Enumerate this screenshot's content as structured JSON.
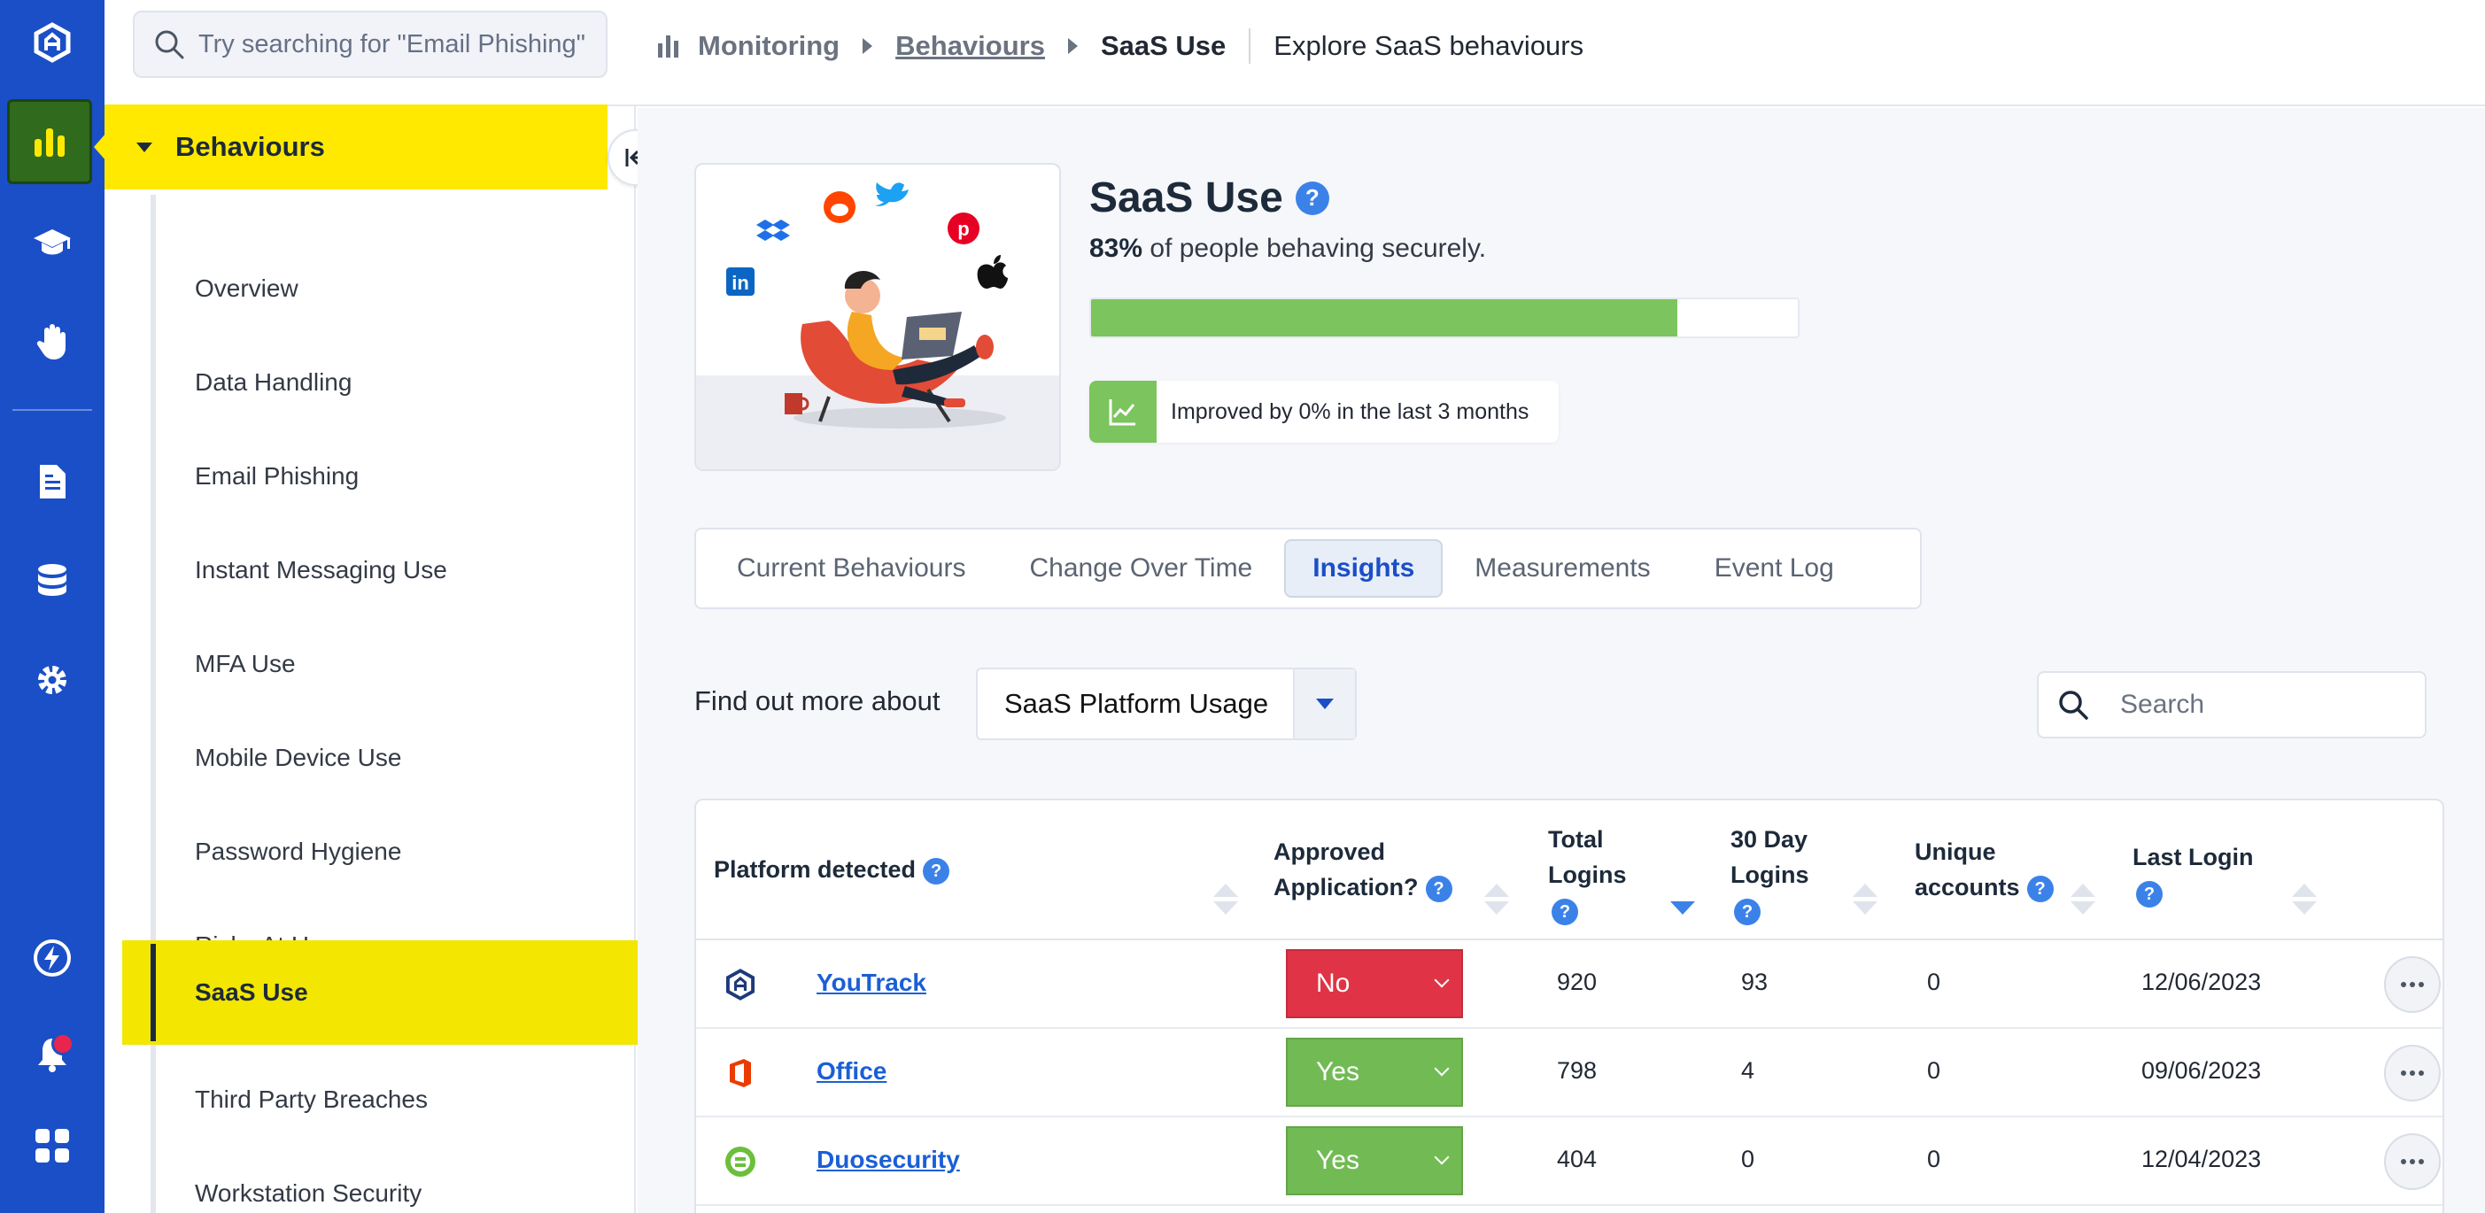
{
  "search": {
    "placeholder": "Try searching for \"Email Phishing\""
  },
  "breadcrumb": {
    "monitoring": "Monitoring",
    "behaviours": "Behaviours",
    "current": "SaaS Use",
    "page_description": "Explore SaaS behaviours"
  },
  "rail": {
    "icons": [
      "logo-icon",
      "chart-icon",
      "graduation-cap-icon",
      "hand-icon",
      "document-icon",
      "database-icon",
      "gear-icon",
      "lightning-icon",
      "bell-icon",
      "grid-icon"
    ]
  },
  "sidebar": {
    "section": "Behaviours",
    "items": [
      {
        "label": "Overview"
      },
      {
        "label": "Data Handling"
      },
      {
        "label": "Email Phishing"
      },
      {
        "label": "Instant Messaging Use"
      },
      {
        "label": "MFA Use"
      },
      {
        "label": "Mobile Device Use"
      },
      {
        "label": "Password Hygiene"
      },
      {
        "label": "Risks At Home"
      },
      {
        "label": "SaaS Use"
      },
      {
        "label": "Third Party Breaches"
      },
      {
        "label": "Workstation Security"
      }
    ],
    "selected_index": 8
  },
  "hero": {
    "title": "SaaS Use",
    "percent": "83%",
    "percent_suffix": " of people behaving securely.",
    "progress_fraction": 0.83,
    "trend_text": "Improved by 0% in the last 3 months"
  },
  "tabs": [
    {
      "label": "Current Behaviours"
    },
    {
      "label": "Change Over Time"
    },
    {
      "label": "Insights"
    },
    {
      "label": "Measurements"
    },
    {
      "label": "Event Log"
    }
  ],
  "active_tab": "Insights",
  "filter": {
    "label": "Find out more about",
    "selected": "SaaS Platform Usage",
    "search_placeholder": "Search"
  },
  "table": {
    "headers": {
      "platform": "Platform detected",
      "approved_1": "Approved",
      "approved_2": "Application?",
      "total_1": "Total",
      "total_2": "Logins",
      "day30_1": "30 Day",
      "day30_2": "Logins",
      "unique_1": "Unique",
      "unique_2": "accounts",
      "last": "Last Login"
    },
    "rows": [
      {
        "platform": "YouTrack",
        "approved": "No",
        "total": "920",
        "day30": "93",
        "unique": "0",
        "last": "12/06/2023"
      },
      {
        "platform": "Office",
        "approved": "Yes",
        "total": "798",
        "day30": "4",
        "unique": "0",
        "last": "09/06/2023"
      },
      {
        "platform": "Duosecurity",
        "approved": "Yes",
        "total": "404",
        "day30": "0",
        "unique": "0",
        "last": "12/04/2023"
      }
    ]
  },
  "colors": {
    "rail": "#1a4fc7",
    "highlight": "#ffe900",
    "success": "#7cc45d",
    "danger": "#e03446",
    "link": "#1a5fd6"
  }
}
